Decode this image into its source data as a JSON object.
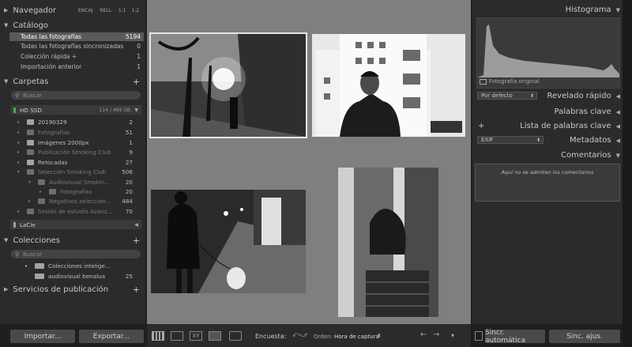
{
  "navigator": {
    "title": "Navegador",
    "zoom_options": [
      "ENCAJ.",
      "RELL.",
      "1:1",
      "1:2"
    ]
  },
  "catalog": {
    "title": "Catálogo",
    "items": [
      {
        "label": "Todas las fotografías",
        "count": "5194"
      },
      {
        "label": "Todas las fotografías sincronizadas",
        "count": "0"
      },
      {
        "label": "Colección rápida  +",
        "count": "1"
      },
      {
        "label": "Importación anterior",
        "count": "1"
      }
    ]
  },
  "folders": {
    "title": "Carpetas",
    "search_placeholder": "Buscar",
    "volume": {
      "name": "HD SSD",
      "capacity": "114 / 499 GB"
    },
    "items": [
      {
        "label": "20190329",
        "count": "2"
      },
      {
        "label": "Fotografías",
        "count": "51"
      },
      {
        "label": "Imágenes 2000px",
        "count": "1"
      },
      {
        "label": "Publicación Smoking Club",
        "count": "9"
      },
      {
        "label": "Retocadas",
        "count": "27"
      },
      {
        "label": "Selección Smoking Club",
        "count": "506"
      },
      {
        "label": "Audiovisual Smokin…",
        "count": "20"
      },
      {
        "label": "Fotografías",
        "count": "20"
      },
      {
        "label": "Negativos seleccion…",
        "count": "484"
      },
      {
        "label": "Sesión de estudio Avanz…",
        "count": "70"
      }
    ],
    "volume2": "LaCie"
  },
  "collections": {
    "title": "Colecciones",
    "search_placeholder": "Buscar",
    "items": [
      {
        "label": "Colecciones intelige…",
        "count": ""
      },
      {
        "label": "audiovisual benalua",
        "count": "25"
      }
    ]
  },
  "publish": {
    "title": "Servicios de publicación"
  },
  "left_buttons": {
    "import": "Importar...",
    "export": "Exportar..."
  },
  "right": {
    "histogram": "Histograma",
    "original_photo": "Fotografía original",
    "quick_develop": "Revelado rápido",
    "preset": "Por defecto",
    "keywords": "Palabras clave",
    "keyword_list": "Lista de palabras clave",
    "metadata": "Metadatos",
    "metadata_preset": "EXIF",
    "comments": "Comentarios",
    "comments_note": "Aquí no se admiten los comentarios",
    "sync_auto": "Sincr. automática",
    "sync_settings": "Sinc. ajus."
  },
  "toolbar": {
    "survey_label": "Encuesta:",
    "order_label": "Orden:",
    "order_value": "Hora de captura"
  }
}
